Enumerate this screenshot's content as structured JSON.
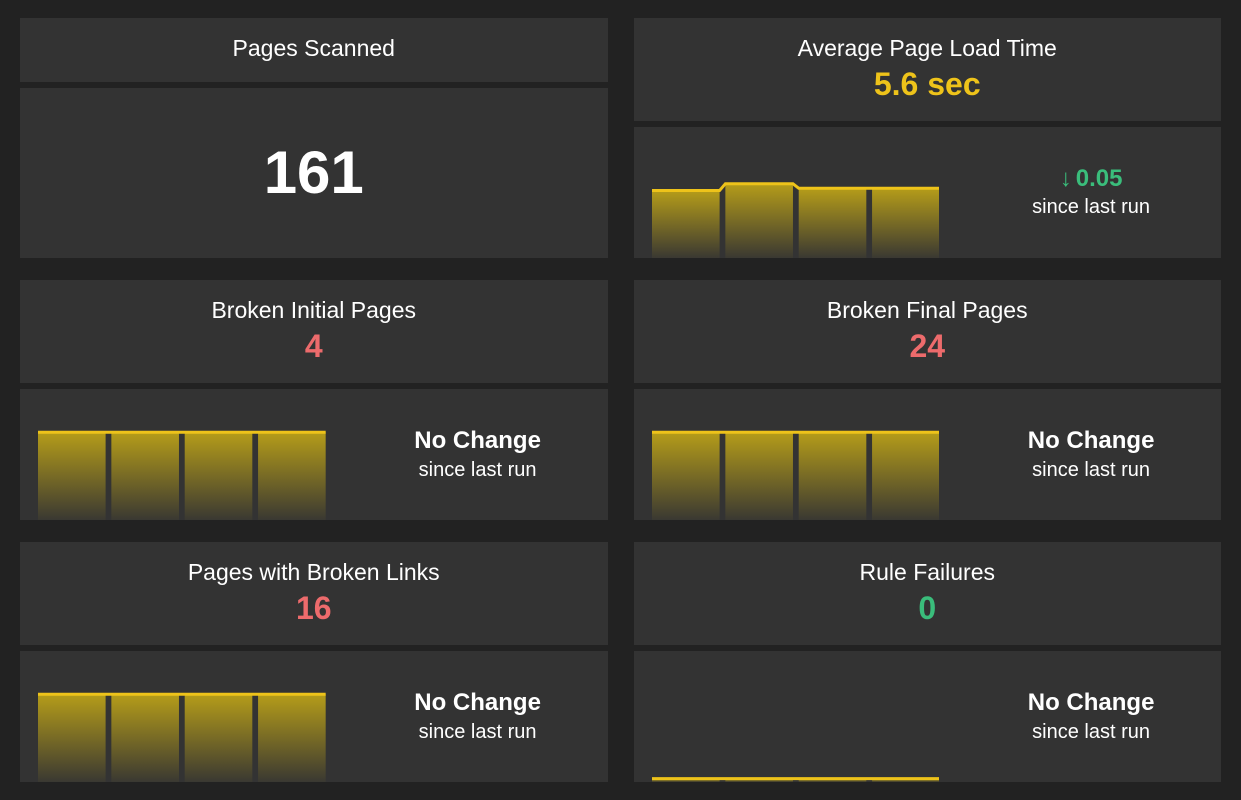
{
  "cards": {
    "pages_scanned": {
      "title": "Pages Scanned",
      "value": "161"
    },
    "avg_load": {
      "title": "Average Page Load Time",
      "value": "5.6 sec",
      "delta_value": "0.05",
      "delta_direction": "down",
      "delta_sub": "since last run"
    },
    "broken_initial": {
      "title": "Broken Initial Pages",
      "value": "4",
      "change_main": "No Change",
      "change_sub": "since last run"
    },
    "broken_final": {
      "title": "Broken Final Pages",
      "value": "24",
      "change_main": "No Change",
      "change_sub": "since last run"
    },
    "broken_links": {
      "title": "Pages with Broken Links",
      "value": "16",
      "change_main": "No Change",
      "change_sub": "since last run"
    },
    "rule_failures": {
      "title": "Rule Failures",
      "value": "0",
      "change_main": "No Change",
      "change_sub": "since last run"
    }
  },
  "chart_data": [
    {
      "card": "avg_load",
      "type": "bar",
      "values": [
        60,
        66,
        62,
        62
      ],
      "ylim": [
        0,
        80
      ]
    },
    {
      "card": "broken_initial",
      "type": "bar",
      "values": [
        78,
        78,
        78,
        78
      ],
      "ylim": [
        0,
        80
      ]
    },
    {
      "card": "broken_final",
      "type": "bar",
      "values": [
        78,
        78,
        78,
        78
      ],
      "ylim": [
        0,
        80
      ]
    },
    {
      "card": "broken_links",
      "type": "bar",
      "values": [
        78,
        78,
        78,
        78
      ],
      "ylim": [
        0,
        80
      ]
    },
    {
      "card": "rule_failures",
      "type": "bar",
      "values": [
        3,
        3,
        3,
        3
      ],
      "ylim": [
        0,
        80
      ]
    }
  ],
  "colors": {
    "yellow": "#eec31a",
    "red": "#ed6b6c",
    "green": "#3abd7b"
  }
}
